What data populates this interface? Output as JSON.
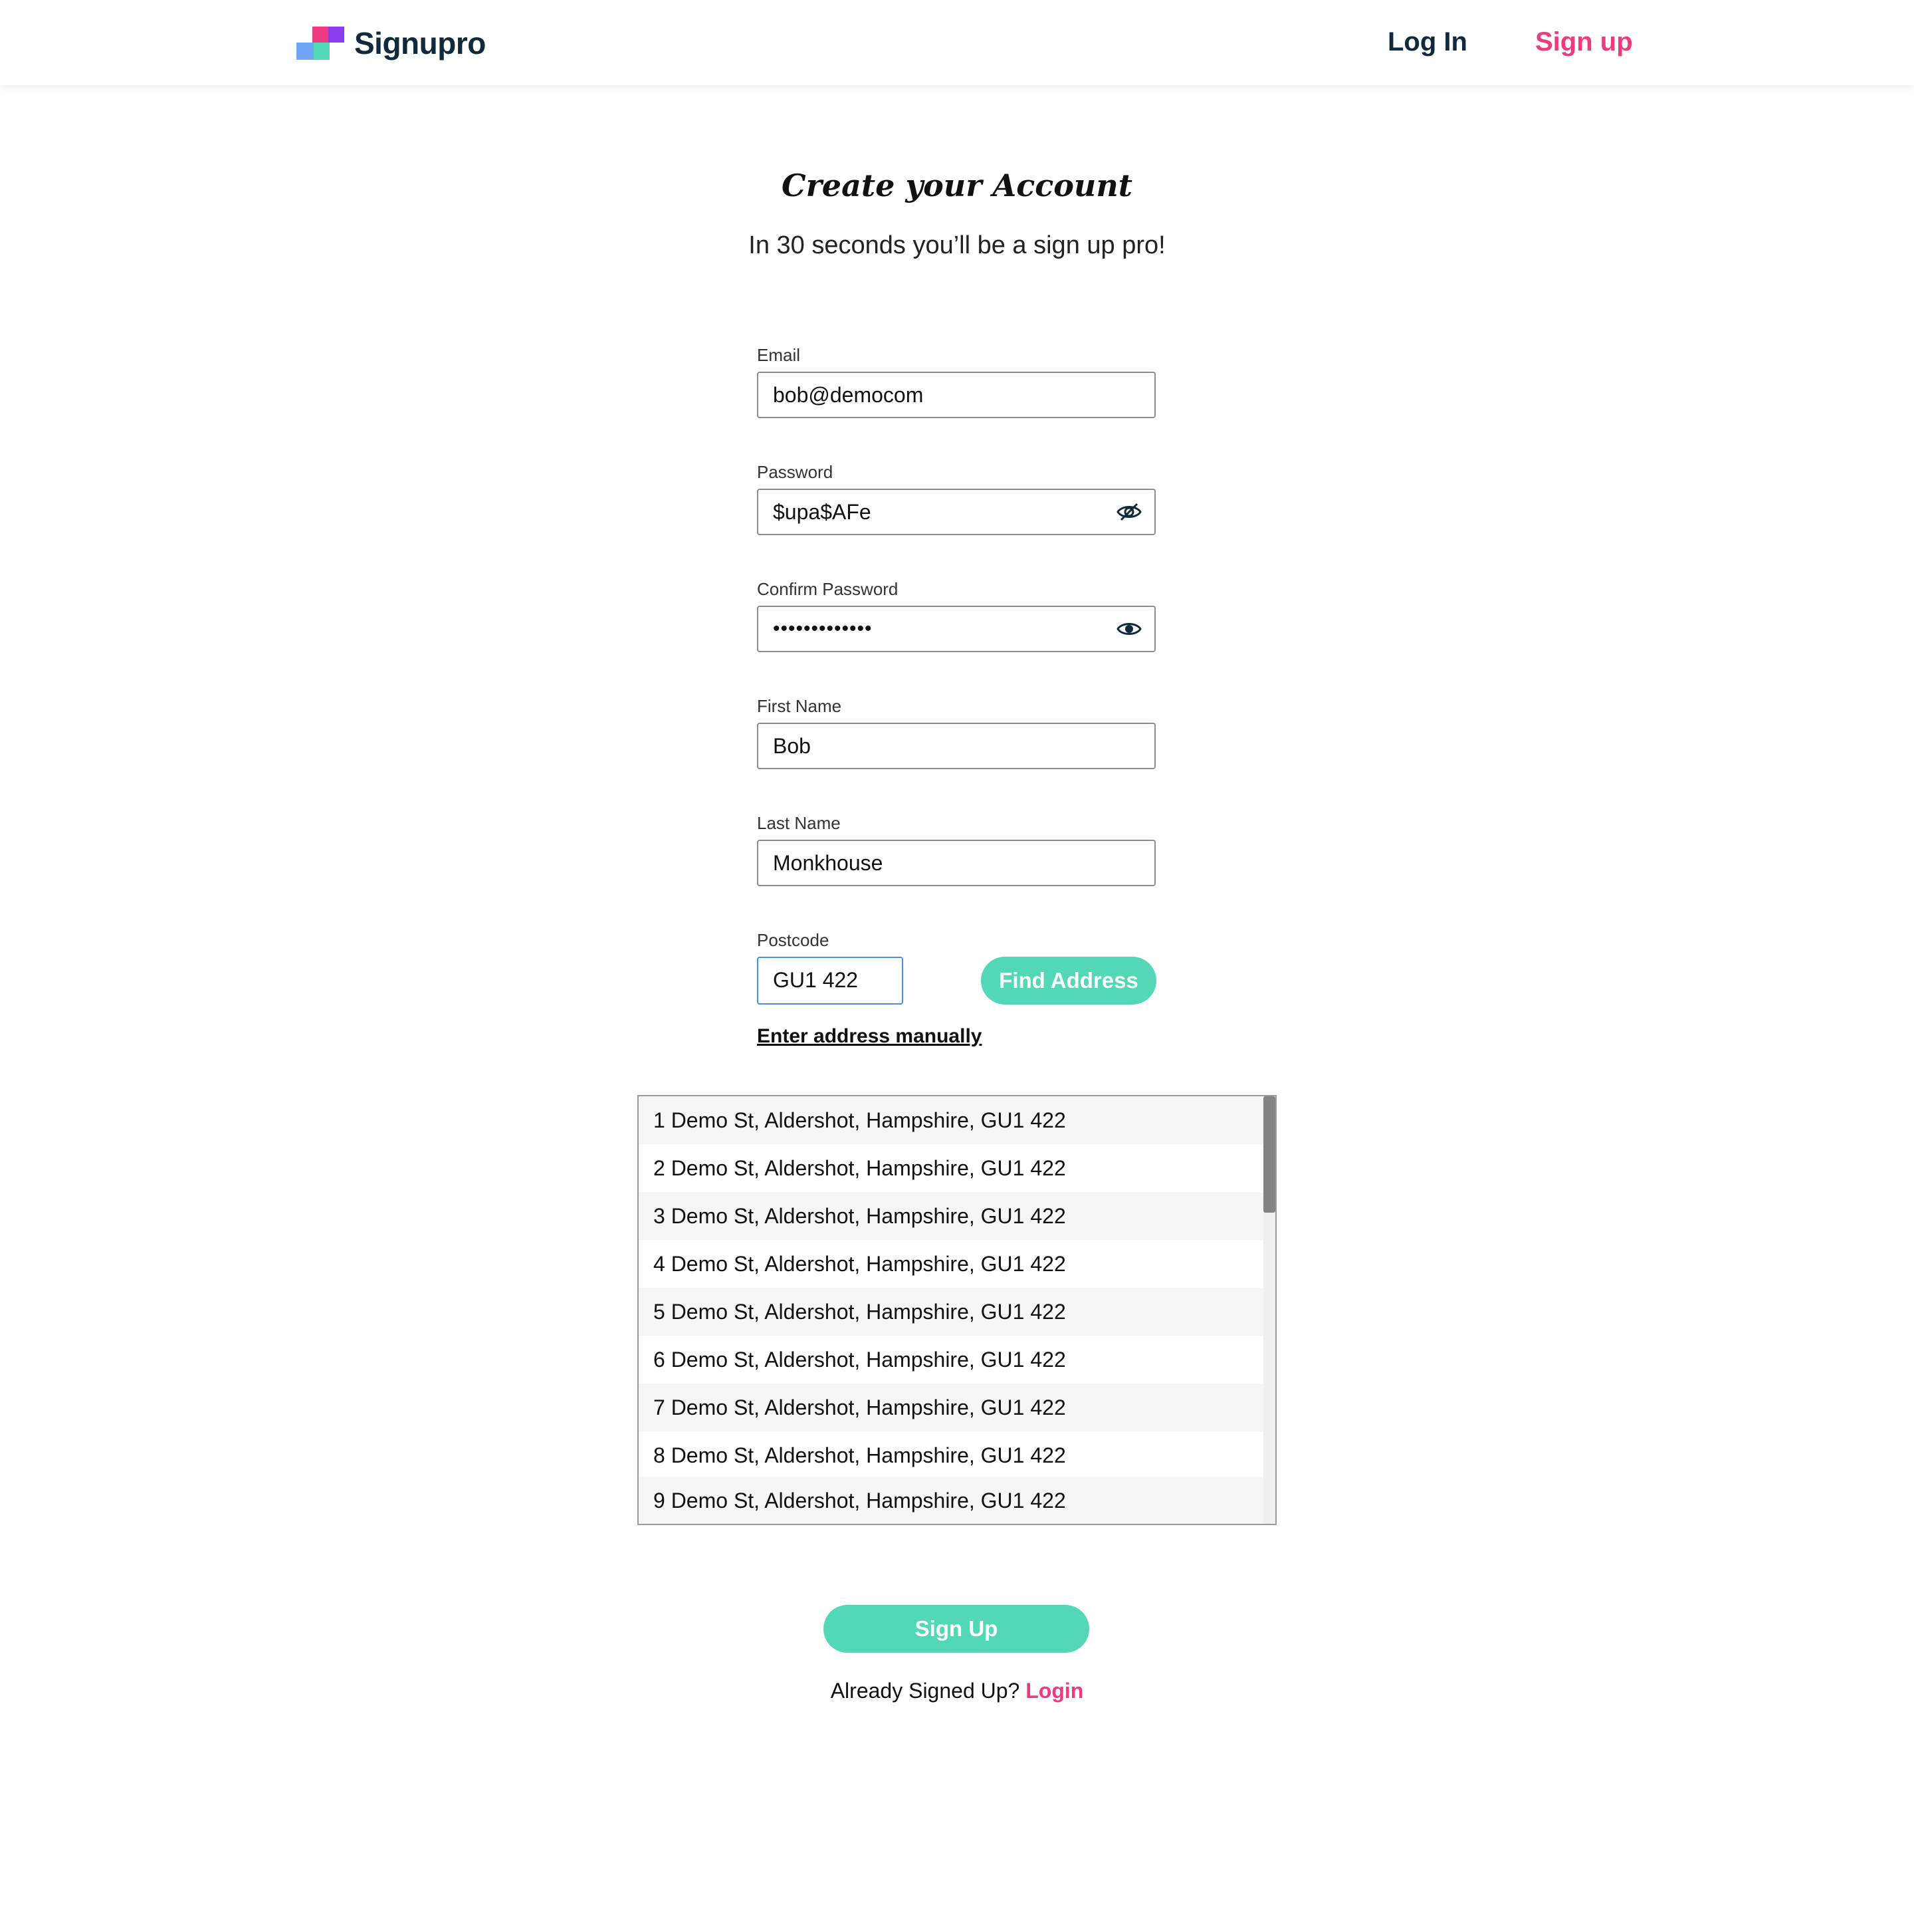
{
  "brand": {
    "name": "Signupro",
    "colors": {
      "navy": "#0f2a3d",
      "pink": "#ee3a7f",
      "teal": "#52d8b6",
      "purple": "#8a3cf0",
      "blue": "#6ea6f5"
    }
  },
  "nav": {
    "login": "Log In",
    "signup": "Sign up"
  },
  "page": {
    "title": "Create your Account",
    "subtitle": "In 30 seconds you’ll be a sign up pro!"
  },
  "form": {
    "email": {
      "label": "Email",
      "value": "bob@democom"
    },
    "password": {
      "label": "Password",
      "value": "$upa$AFe",
      "icon": "eye-slash-icon"
    },
    "confirm_password": {
      "label": "Confirm Password",
      "value": "•••••••••••••",
      "icon": "eye-icon"
    },
    "first_name": {
      "label": "First Name",
      "value": "Bob"
    },
    "last_name": {
      "label": "Last Name",
      "value": "Monkhouse"
    },
    "postcode": {
      "label": "Postcode",
      "value": "GU1 422"
    },
    "find_address": "Find Address",
    "manual_link": "Enter address manually"
  },
  "addresses": [
    "1 Demo St, Aldershot, Hampshire, GU1 422",
    "2 Demo St, Aldershot, Hampshire, GU1 422",
    "3 Demo St, Aldershot, Hampshire, GU1 422",
    "4 Demo St, Aldershot, Hampshire, GU1 422",
    "5 Demo St, Aldershot, Hampshire, GU1 422",
    "6 Demo St, Aldershot, Hampshire, GU1 422",
    "7 Demo St, Aldershot, Hampshire, GU1 422",
    "8 Demo St, Aldershot, Hampshire, GU1 422",
    "9 Demo St, Aldershot, Hampshire, GU1 422"
  ],
  "footer": {
    "signup_button": "Sign Up",
    "already_text": "Already Signed Up?",
    "login_link": "Login"
  }
}
